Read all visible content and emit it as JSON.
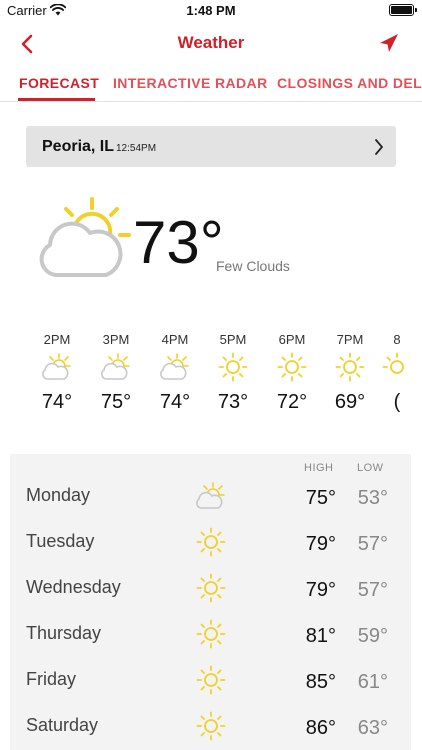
{
  "status_bar": {
    "carrier": "Carrier",
    "time": "1:48 PM",
    "icons": [
      "wifi-icon",
      "battery-icon"
    ]
  },
  "nav": {
    "title": "Weather",
    "back_icon": "chevron-left-icon",
    "location_icon": "location-arrow-icon"
  },
  "tabs": [
    {
      "label": "FORECAST",
      "active": true
    },
    {
      "label": "INTERACTIVE RADAR",
      "active": false
    },
    {
      "label": "CLOSINGS AND DELA",
      "active": false
    }
  ],
  "location": {
    "city": "Peoria, IL",
    "updated": "12:54PM"
  },
  "current": {
    "temp": "73°",
    "description": "Few Clouds",
    "icon": "partly-cloudy-icon"
  },
  "hourly": [
    {
      "time": "2PM",
      "temp": "74°",
      "icon": "partly-cloudy-icon"
    },
    {
      "time": "3PM",
      "temp": "75°",
      "icon": "partly-cloudy-icon"
    },
    {
      "time": "4PM",
      "temp": "74°",
      "icon": "partly-cloudy-icon"
    },
    {
      "time": "5PM",
      "temp": "73°",
      "icon": "sun-icon"
    },
    {
      "time": "6PM",
      "temp": "72°",
      "icon": "sun-icon"
    },
    {
      "time": "7PM",
      "temp": "69°",
      "icon": "sun-icon"
    },
    {
      "time": "8",
      "temp": "(",
      "icon": "sun-icon"
    }
  ],
  "daily": {
    "high_header": "HIGH",
    "low_header": "LOW",
    "days": [
      {
        "day": "Monday",
        "high": "75°",
        "low": "53°",
        "icon": "partly-cloudy-icon"
      },
      {
        "day": "Tuesday",
        "high": "79°",
        "low": "57°",
        "icon": "sun-icon"
      },
      {
        "day": "Wednesday",
        "high": "79°",
        "low": "57°",
        "icon": "sun-icon"
      },
      {
        "day": "Thursday",
        "high": "81°",
        "low": "59°",
        "icon": "sun-icon"
      },
      {
        "day": "Friday",
        "high": "85°",
        "low": "61°",
        "icon": "sun-icon"
      },
      {
        "day": "Saturday",
        "high": "86°",
        "low": "63°",
        "icon": "sun-icon"
      }
    ]
  },
  "colors": {
    "accent": "#d0202a",
    "tab_inactive": "#e0515a",
    "sun": "#f1d02a",
    "cloud": "#c8c8c8"
  }
}
